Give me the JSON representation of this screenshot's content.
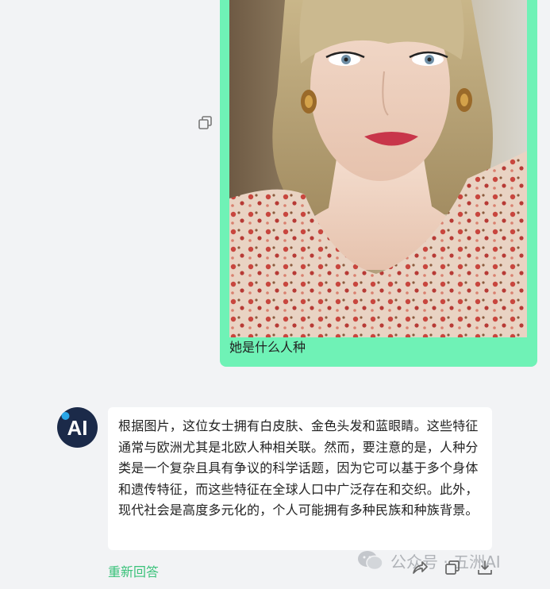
{
  "user_message": {
    "image_alt": "uploaded photo of a woman",
    "text": "她是什么人种"
  },
  "assistant": {
    "avatar_label": "AI",
    "response": "根据图片，这位女士拥有白皮肤、金色头发和蓝眼睛。这些特征通常与欧洲尤其是北欧人种相关联。然而，要注意的是，人种分类是一个复杂且具有争议的科学话题，因为它可以基于多个身体和遗传特征，而这些特征在全球人口中广泛存在和交织。此外，现代社会是高度多元化的，个人可能拥有多种民族和种族背景。"
  },
  "actions": {
    "regenerate_label": "重新回答"
  },
  "watermark": {
    "text": "公众号 · 五洲AI"
  },
  "colors": {
    "background": "#f2f3f5",
    "user_bubble": "#6ff2b6",
    "regenerate": "#3ac27a",
    "avatar_bg": "#1b2a49",
    "avatar_dot": "#2aa7e8"
  },
  "icons": {
    "top_copy": "copy-icon",
    "share": "share-icon",
    "copy": "copy-icon",
    "download": "download-icon",
    "watermark_logo": "wechat-icon"
  }
}
